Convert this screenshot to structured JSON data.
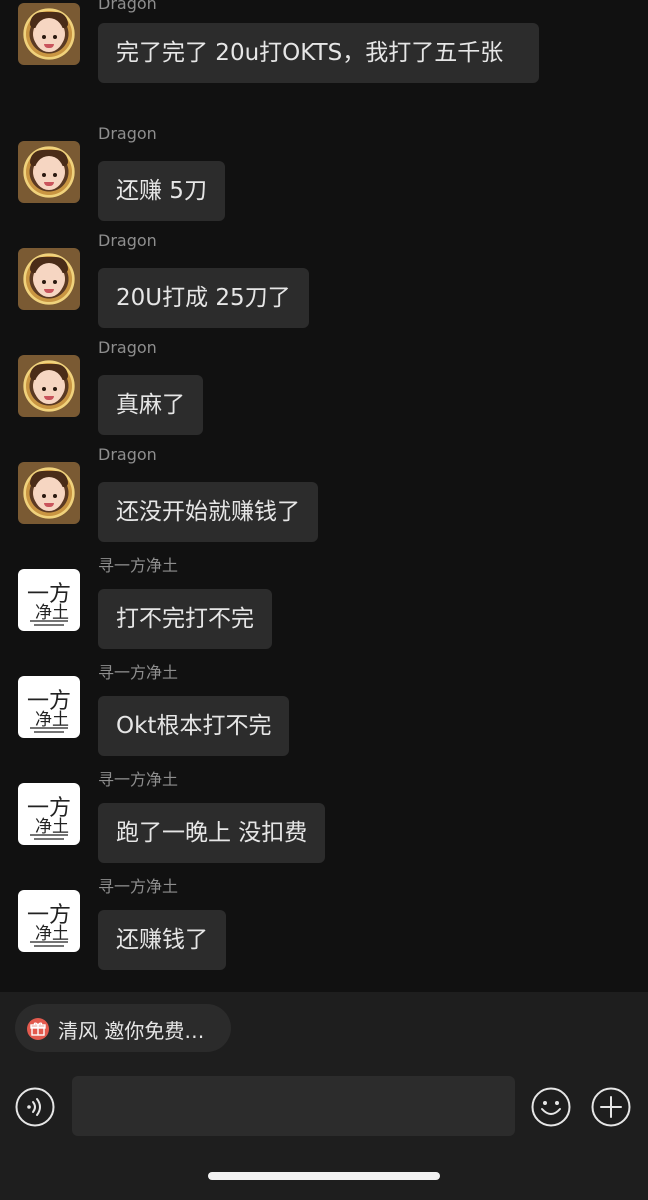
{
  "chat": {
    "messages": [
      {
        "sender": "Dragon",
        "text": "完了完了 20u打OKTS，我打了五千张",
        "avatar": "dragon-avatar"
      },
      {
        "sender": "Dragon",
        "text": "还赚 5刀",
        "avatar": "dragon-avatar"
      },
      {
        "sender": "Dragon",
        "text": "20U打成 25刀了",
        "avatar": "dragon-avatar"
      },
      {
        "sender": "Dragon",
        "text": "真麻了",
        "avatar": "dragon-avatar"
      },
      {
        "sender": "Dragon",
        "text": "还没开始就赚钱了",
        "avatar": "dragon-avatar"
      },
      {
        "sender": "寻一方净土",
        "text": "打不完打不完",
        "avatar": "pure-land-avatar"
      },
      {
        "sender": "寻一方净土",
        "text": "Okt根本打不完",
        "avatar": "pure-land-avatar"
      },
      {
        "sender": "寻一方净土",
        "text": "跑了一晚上 没扣费",
        "avatar": "pure-land-avatar"
      },
      {
        "sender": "寻一方净土",
        "text": "还赚钱了",
        "avatar": "pure-land-avatar"
      }
    ]
  },
  "invite": {
    "label": "清风 邀你免费…",
    "icon": "gift-icon",
    "icon_color": "#e35a4e"
  },
  "input_bar": {
    "placeholder": "",
    "icons": [
      "voice-icon",
      "emoji-icon",
      "plus-icon"
    ]
  },
  "colors": {
    "background": "#111111",
    "bubble": "#2c2c2c",
    "text": "#e6e6e6",
    "name_text": "#8e8e8e",
    "bottom_bar": "#1e1e1e"
  }
}
